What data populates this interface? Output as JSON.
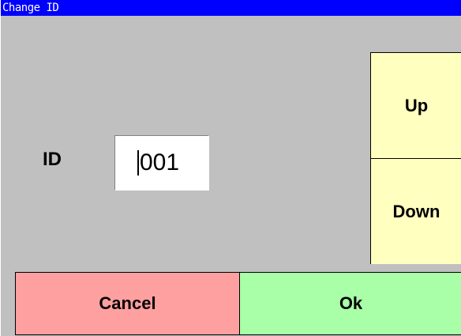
{
  "window": {
    "title": "Change ID"
  },
  "form": {
    "id_label": "ID",
    "id_value": "001"
  },
  "spinner": {
    "up_label": "Up",
    "down_label": "Down"
  },
  "actions": {
    "cancel_label": "Cancel",
    "ok_label": "Ok"
  },
  "colors": {
    "title_bar": "#0000ff",
    "background": "#c0c0c0",
    "spinner_button": "#ffffc0",
    "cancel_button": "#ffa0a0",
    "ok_button": "#a8ffa8"
  }
}
